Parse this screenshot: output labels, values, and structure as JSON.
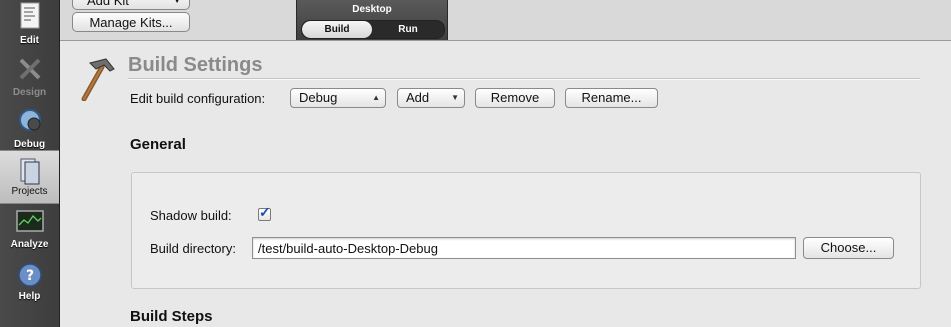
{
  "modes": [
    {
      "name": "mode-edit",
      "label": "Edit",
      "icon": "edit-document-icon",
      "state": "normal"
    },
    {
      "name": "mode-design",
      "label": "Design",
      "icon": "design-tools-icon",
      "state": "disabled"
    },
    {
      "name": "mode-debug",
      "label": "Debug",
      "icon": "debug-bug-icon",
      "state": "normal"
    },
    {
      "name": "mode-projects",
      "label": "Projects",
      "icon": "projects-folder-icon",
      "state": "active"
    },
    {
      "name": "mode-analyze",
      "label": "Analyze",
      "icon": "analyze-monitor-icon",
      "state": "normal"
    },
    {
      "name": "mode-help",
      "label": "Help",
      "icon": "help-question-icon",
      "state": "normal"
    }
  ],
  "kits": {
    "add_kit_label": "Add Kit",
    "manage_kits_label": "Manage Kits..."
  },
  "target": {
    "title": "Desktop",
    "tabs": [
      "Build",
      "Run"
    ],
    "active_tab": "Build"
  },
  "build_settings": {
    "heading": "Build Settings",
    "edit_config_label": "Edit build configuration:",
    "config_value": "Debug",
    "add_label": "Add",
    "remove_label": "Remove",
    "rename_label": "Rename..."
  },
  "general": {
    "title": "General",
    "shadow_build_label": "Shadow build:",
    "shadow_build_checked": true,
    "build_dir_label": "Build directory:",
    "build_dir_value": "/test/build-auto-Desktop-Debug",
    "choose_label": "Choose..."
  },
  "build_steps": {
    "title": "Build Steps"
  },
  "colors": {
    "sidebar_bg": "#444444",
    "panel_bg": "#e8e8e8",
    "heading_gray": "#8a8a8a",
    "check_blue": "#1a4fb0"
  }
}
